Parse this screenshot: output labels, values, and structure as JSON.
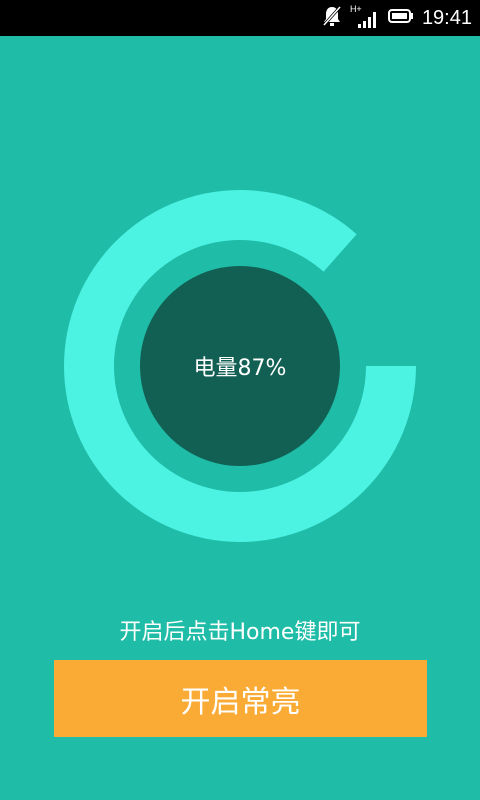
{
  "status_bar": {
    "time": "19:41",
    "network_type": "H+",
    "icons": [
      "notifications-muted-icon",
      "signal-icon",
      "battery-icon"
    ]
  },
  "gauge": {
    "label": "电量87%",
    "level_percent": 87,
    "colors": {
      "background": "#1fbca7",
      "ring": "#4cf2e2",
      "inner": "#126053"
    }
  },
  "hint_text": "开启后点击Home键即可",
  "action_button": {
    "label": "开启常亮",
    "color": "#f9ab36"
  }
}
